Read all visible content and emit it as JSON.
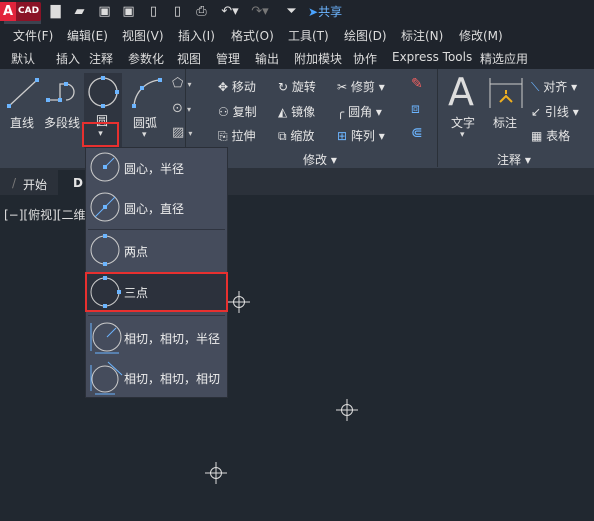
{
  "app": {
    "logo_letter": "A",
    "logo_text": "CAD",
    "share": "共享"
  },
  "quick_access": [
    "new-icon",
    "open-icon",
    "save-icon",
    "save-as-icon",
    "open-from-mobile-icon",
    "save-to-mobile-icon",
    "plot-icon",
    "undo-icon",
    "redo-icon",
    "customize-icon"
  ],
  "menu": [
    "文件(F)",
    "编辑(E)",
    "视图(V)",
    "插入(I)",
    "格式(O)",
    "工具(T)",
    "绘图(D)",
    "标注(N)",
    "修改(M)"
  ],
  "tabs": [
    "默认",
    "插入",
    "注释",
    "参数化",
    "视图",
    "管理",
    "输出",
    "附加模块",
    "协作",
    "Express Tools",
    "精选应用"
  ],
  "active_tab": "默认",
  "draw": {
    "line": "直线",
    "polyline": "多段线",
    "circle": "圆",
    "arc": "圆弧"
  },
  "modify": {
    "title": "修改",
    "move": "移动",
    "rotate": "旋转",
    "trim": "修剪",
    "copy": "复制",
    "mirror": "镜像",
    "fillet": "圆角",
    "stretch": "拉伸",
    "scale": "缩放",
    "array": "阵列"
  },
  "annotation": {
    "title": "注释",
    "text": "文字",
    "dimension": "标注",
    "align": "对齐",
    "leader": "引线",
    "table": "表格"
  },
  "file_tabs": {
    "start": "开始",
    "drawing": "D"
  },
  "viewport_label": "[−][俯视][二维",
  "circle_menu": [
    {
      "label": "圆心，半径",
      "icon": "circle-center-radius-icon"
    },
    {
      "label": "圆心，直径",
      "icon": "circle-center-diameter-icon"
    },
    {
      "label": "两点",
      "icon": "circle-2point-icon"
    },
    {
      "label": "三点",
      "icon": "circle-3point-icon",
      "selected": true
    },
    {
      "label": "相切，相切，半径",
      "icon": "circle-ttr-icon"
    },
    {
      "label": "相切，相切，相切",
      "icon": "circle-ttt-icon"
    }
  ],
  "colors": {
    "accent": "#6cb5ff",
    "highlight": "#e8302f"
  }
}
